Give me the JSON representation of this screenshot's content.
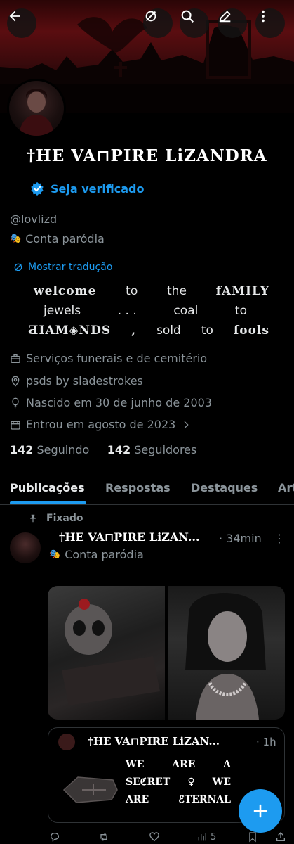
{
  "profile": {
    "display_name": "†HE VA⊓PIRE LiZANDRA",
    "verify_label": "Seja verificado",
    "handle": "@lovlizd",
    "parody_label": "Conta paródia",
    "translate_label": "Mostrar tradução",
    "bio": {
      "line1": [
        "welcome",
        "to",
        "the",
        "fAMILY"
      ],
      "line2": [
        "jewels",
        ". . .",
        "coal",
        "to"
      ],
      "line3": [
        "ƋIAM◈NDS",
        ",",
        "sold",
        "to",
        "fools"
      ]
    },
    "category": "Serviços funerais e de cemitério",
    "location": "psds  by  sladestrokes",
    "birthday": "Nascido em 30 de junho de 2003",
    "joined": "Entrou em agosto de 2023",
    "following_count": "142",
    "following_label": "Seguindo",
    "followers_count": "142",
    "followers_label": "Seguidores"
  },
  "tabs": [
    "Publicações",
    "Respostas",
    "Destaques",
    "Art"
  ],
  "post": {
    "pinned_label": "Fixado",
    "author": "†HE VA⊓PIRE LiZAN...",
    "time": "· 34min",
    "parody_label": "Conta paródia",
    "quote": {
      "author": "†HE VA⊓PIRE LiZAN...",
      "time": "· 1h",
      "line1": [
        "WE",
        "ARE",
        "Λ"
      ],
      "line2": [
        "SEℭRET",
        "♀",
        "WE"
      ],
      "line3": [
        "ARE",
        "ℰTERNAL"
      ]
    },
    "views": "5"
  },
  "colors": {
    "accent": "#1d9bf0",
    "muted": "#8b949a",
    "text": "#e7e9ea",
    "background": "#000000"
  },
  "icons": [
    "back-arrow-icon",
    "translate-icon",
    "search-icon",
    "edit-icon",
    "more-icon",
    "verified-badge-icon",
    "parody-mask-icon",
    "briefcase-icon",
    "location-pin-icon",
    "balloon-icon",
    "calendar-icon",
    "chevron-right-icon",
    "pin-icon",
    "reply-icon",
    "repost-icon",
    "like-icon",
    "views-icon",
    "bookmark-icon",
    "share-icon",
    "plus-icon"
  ]
}
